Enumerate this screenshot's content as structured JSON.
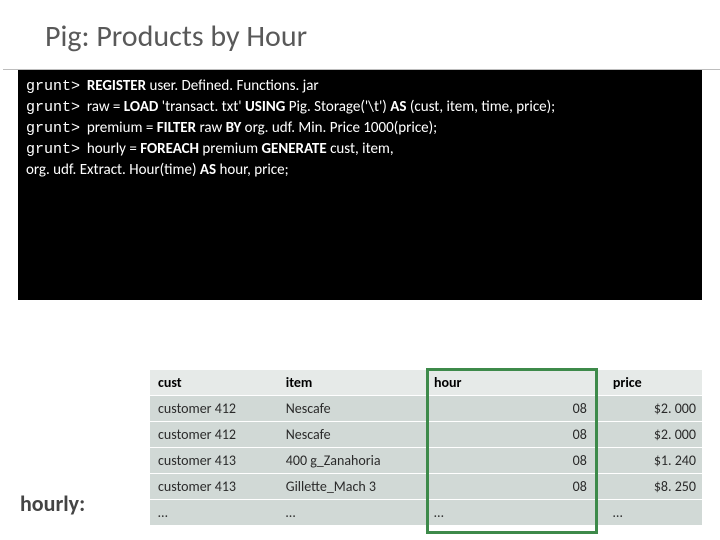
{
  "title": "Pig: Products by Hour",
  "prompt": "grunt>",
  "code": {
    "l1a": "REGISTER ",
    "l1b": "user. Defined. Functions. jar",
    "l2a": "raw = ",
    "l2b": "LOAD ",
    "l2c": "'transact. txt' ",
    "l2d": "USING ",
    "l2e": "Pig. Storage('\\t') ",
    "l2f": "AS ",
    "l2g": "(cust, item, time, price);",
    "l3a": "premium = ",
    "l3b": "FILTER ",
    "l3c": "raw ",
    "l3d": "BY ",
    "l3e": "org. udf. Min. Price 1000(price);",
    "l4a": "hourly = ",
    "l4b": "FOREACH ",
    "l4c": "premium ",
    "l4d": "GENERATE ",
    "l4e": "cust, item,",
    "l5": "org. udf. Extract. Hour(time) ",
    "l5b": "AS ",
    "l5c": "hour, price;"
  },
  "table": {
    "label": "hourly:",
    "headers": {
      "cust": "cust",
      "item": "item",
      "hour": "hour",
      "price": "price"
    },
    "rows": [
      {
        "cust": "customer 412",
        "item": "Nescafe",
        "hour": "08",
        "price": "$2. 000"
      },
      {
        "cust": "customer 412",
        "item": "Nescafe",
        "hour": "08",
        "price": "$2. 000"
      },
      {
        "cust": "customer 413",
        "item": "400 g_Zanahoria",
        "hour": "08",
        "price": "$1. 240"
      },
      {
        "cust": "customer 413",
        "item": "Gillette_Mach 3",
        "hour": "08",
        "price": "$8. 250"
      },
      {
        "cust": "…",
        "item": "…",
        "hour": "…",
        "price": "…"
      }
    ]
  }
}
